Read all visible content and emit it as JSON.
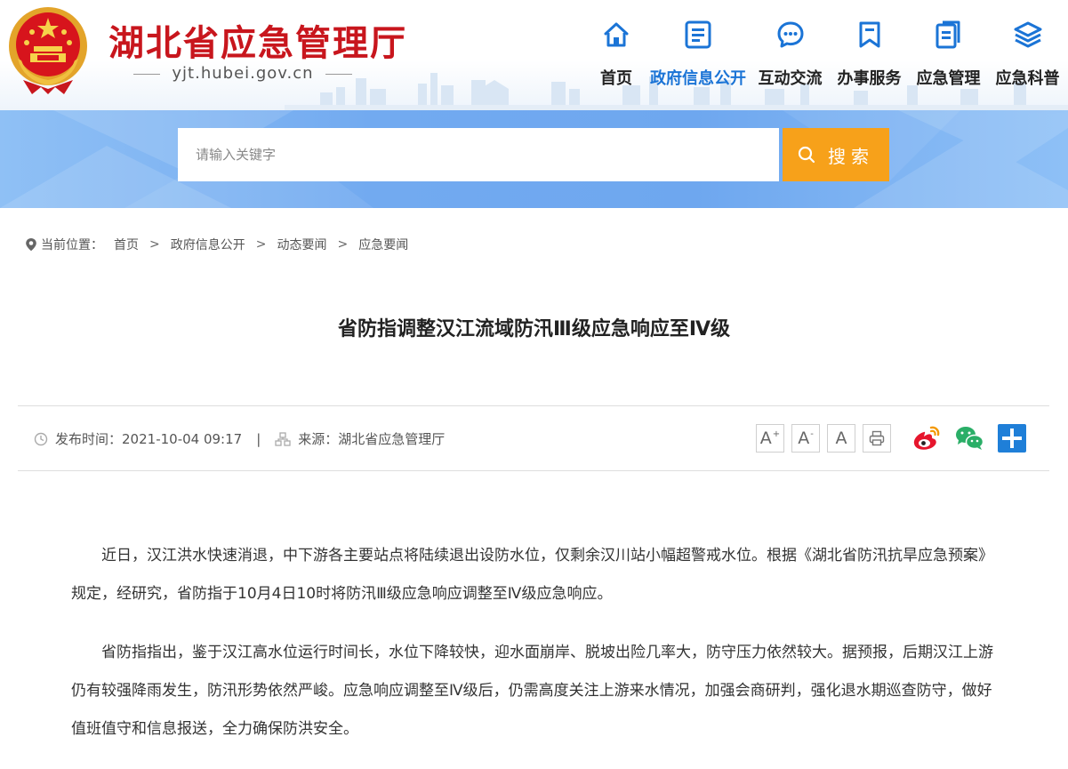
{
  "header": {
    "site_title": "湖北省应急管理厅",
    "site_domain": "yjt.hubei.gov.cn",
    "nav": [
      {
        "label": "首页",
        "icon": "home-icon"
      },
      {
        "label": "政府信息公开",
        "icon": "document-icon",
        "active": true
      },
      {
        "label": "互动交流",
        "icon": "chat-icon"
      },
      {
        "label": "办事服务",
        "icon": "bookmark-icon"
      },
      {
        "label": "应急管理",
        "icon": "files-icon"
      },
      {
        "label": "应急科普",
        "icon": "layers-icon"
      }
    ]
  },
  "search": {
    "placeholder": "请输入关键字",
    "button_label": "搜索"
  },
  "breadcrumb": {
    "label": "当前位置：",
    "items": [
      "首页",
      "政府信息公开",
      "动态要闻",
      "应急要闻"
    ],
    "separator": ">"
  },
  "article": {
    "title": "省防指调整汉江流域防汛Ⅲ级应急响应至Ⅳ级",
    "publish_label": "发布时间：",
    "publish_time": "2021-10-04 09:17",
    "divider": "|",
    "source_label": "来源：",
    "source": "湖北省应急管理厅",
    "font_buttons": [
      "A",
      "A",
      "A"
    ],
    "paragraphs": [
      "近日，汉江洪水快速消退，中下游各主要站点将陆续退出设防水位，仅剩余汉川站小幅超警戒水位。根据《湖北省防汛抗旱应急预案》规定，经研究，省防指于10月4日10时将防汛Ⅲ级应急响应调整至Ⅳ级应急响应。",
      "省防指指出，鉴于汉江高水位运行时间长，水位下降较快，迎水面崩岸、脱坡出险几率大，防守压力依然较大。据预报，后期汉江上游仍有较强降雨发生，防汛形势依然严峻。应急响应调整至Ⅳ级后，仍需高度关注上游来水情况，加强会商研判，强化退水期巡查防守，做好值班值守和信息报送，全力确保防洪安全。"
    ]
  },
  "colors": {
    "brand_red": "#c8161d",
    "nav_active": "#1b74d6",
    "search_button": "#f7a11a",
    "weibo": "#e6162d",
    "wechat": "#2aae67",
    "more_share": "#1f7fd8"
  }
}
